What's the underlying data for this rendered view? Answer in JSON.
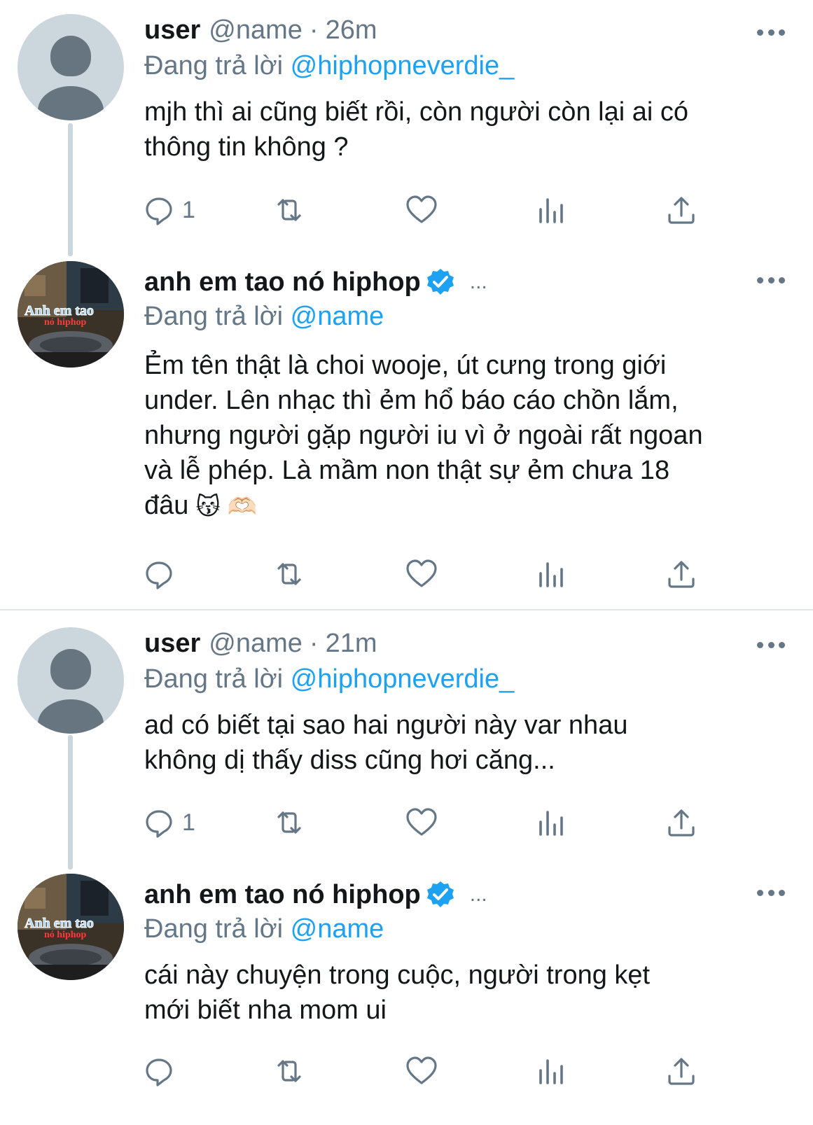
{
  "colors": {
    "link": "#1da1f2",
    "secondary_text": "#657786",
    "primary_text": "#14171a",
    "divider": "#e1e8ed",
    "thread_line": "#ccd6dd"
  },
  "tweets": [
    {
      "display_name": "user",
      "handle": "@name",
      "separator": "·",
      "time": "26m",
      "reply_prefix": "Đang trả lời",
      "reply_to": "@hiphopneverdie_",
      "text": "mjh thì ai cũng biết rồi, còn người còn lại ai có\nthông tin không ?",
      "reply_count": "1",
      "avatar": "default-avatar-icon"
    },
    {
      "display_name": "anh em tao nó hiphop",
      "header_ellipsis": "...",
      "reply_prefix": "Đang trả lời",
      "reply_to": "@name",
      "text": "Ẻm tên thật là choi wooje, út cưng trong giới\nunder. Lên nhạc thì ẻm hổ báo cáo chồn lắm,\nnhưng người gặp người iu vì ở ngoài rất ngoan\nvà lễ phép. Là mầm non thật sự ẻm chưa 18\nđâu",
      "emoji_1": "😽",
      "emoji_2": "🫶🏻",
      "reply_count": "",
      "avatar_text_1": "Anh em tao",
      "avatar_text_2": "nó hiphop"
    },
    {
      "display_name": "user",
      "handle": "@name",
      "separator": "·",
      "time": "21m",
      "reply_prefix": "Đang trả lời",
      "reply_to": "@hiphopneverdie_",
      "text": "ad có biết tại sao hai người này var nhau\nkhông dị thấy diss cũng hơi căng...",
      "reply_count": "1",
      "avatar": "default-avatar-icon"
    },
    {
      "display_name": "anh em tao nó hiphop",
      "header_ellipsis": "...",
      "reply_prefix": "Đang trả lời",
      "reply_to": "@name",
      "text": "cái này chuyện trong cuộc, người trong kẹt\nmới biết nha mom ui",
      "reply_count": "",
      "avatar_text_1": "Anh em tao",
      "avatar_text_2": "nó hiphop"
    }
  ],
  "actions": [
    "reply-icon",
    "retweet-icon",
    "like-icon",
    "analytics-icon",
    "share-icon"
  ]
}
